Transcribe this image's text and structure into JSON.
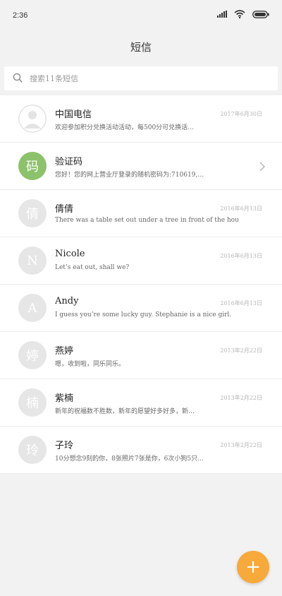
{
  "status": {
    "time": "2:36"
  },
  "title": "短信",
  "search": {
    "placeholder": "搜索11条短信"
  },
  "threads": [
    {
      "name": "中国电信",
      "date": "2017年6月30日",
      "snippet": "欢迎参加积分兑换活动活动，每500分可兑换话…",
      "avatar_type": "person",
      "avatar_text": ""
    },
    {
      "name": "验证码",
      "date": "",
      "snippet": "您好！您的网上营业厅登录的随机密码为:710619,…",
      "avatar_type": "green",
      "avatar_text": "码"
    },
    {
      "name": "倩倩",
      "date": "2016年6月13日",
      "snippet": "There was a table set out under a tree in front of the hous",
      "avatar_type": "gray",
      "avatar_text": "倩"
    },
    {
      "name": "Nicole",
      "date": "2016年6月13日",
      "snippet": "Let’s eat out, shall we?",
      "avatar_type": "gray",
      "avatar_text": "N"
    },
    {
      "name": "Andy",
      "date": "2016年6月13日",
      "snippet": "I guess you’re some lucky guy. Stephanie is a nice girl.",
      "avatar_type": "gray",
      "avatar_text": "A"
    },
    {
      "name": "燕婷",
      "date": "2013年2月22日",
      "snippet": "嗯，收到啦，同乐同乐。",
      "avatar_type": "gray",
      "avatar_text": "婷"
    },
    {
      "name": "紫楠",
      "date": "2013年2月22日",
      "snippet": "新年的祝福数不胜数，新年的愿望好多好多，新…",
      "avatar_type": "gray",
      "avatar_text": "楠"
    },
    {
      "name": "子玲",
      "date": "2013年2月22日",
      "snippet": "10分想念9刻的你，8张照片7张是你，6次小狗5只…",
      "avatar_type": "gray",
      "avatar_text": "玲"
    }
  ],
  "fab": {
    "label": "+"
  }
}
